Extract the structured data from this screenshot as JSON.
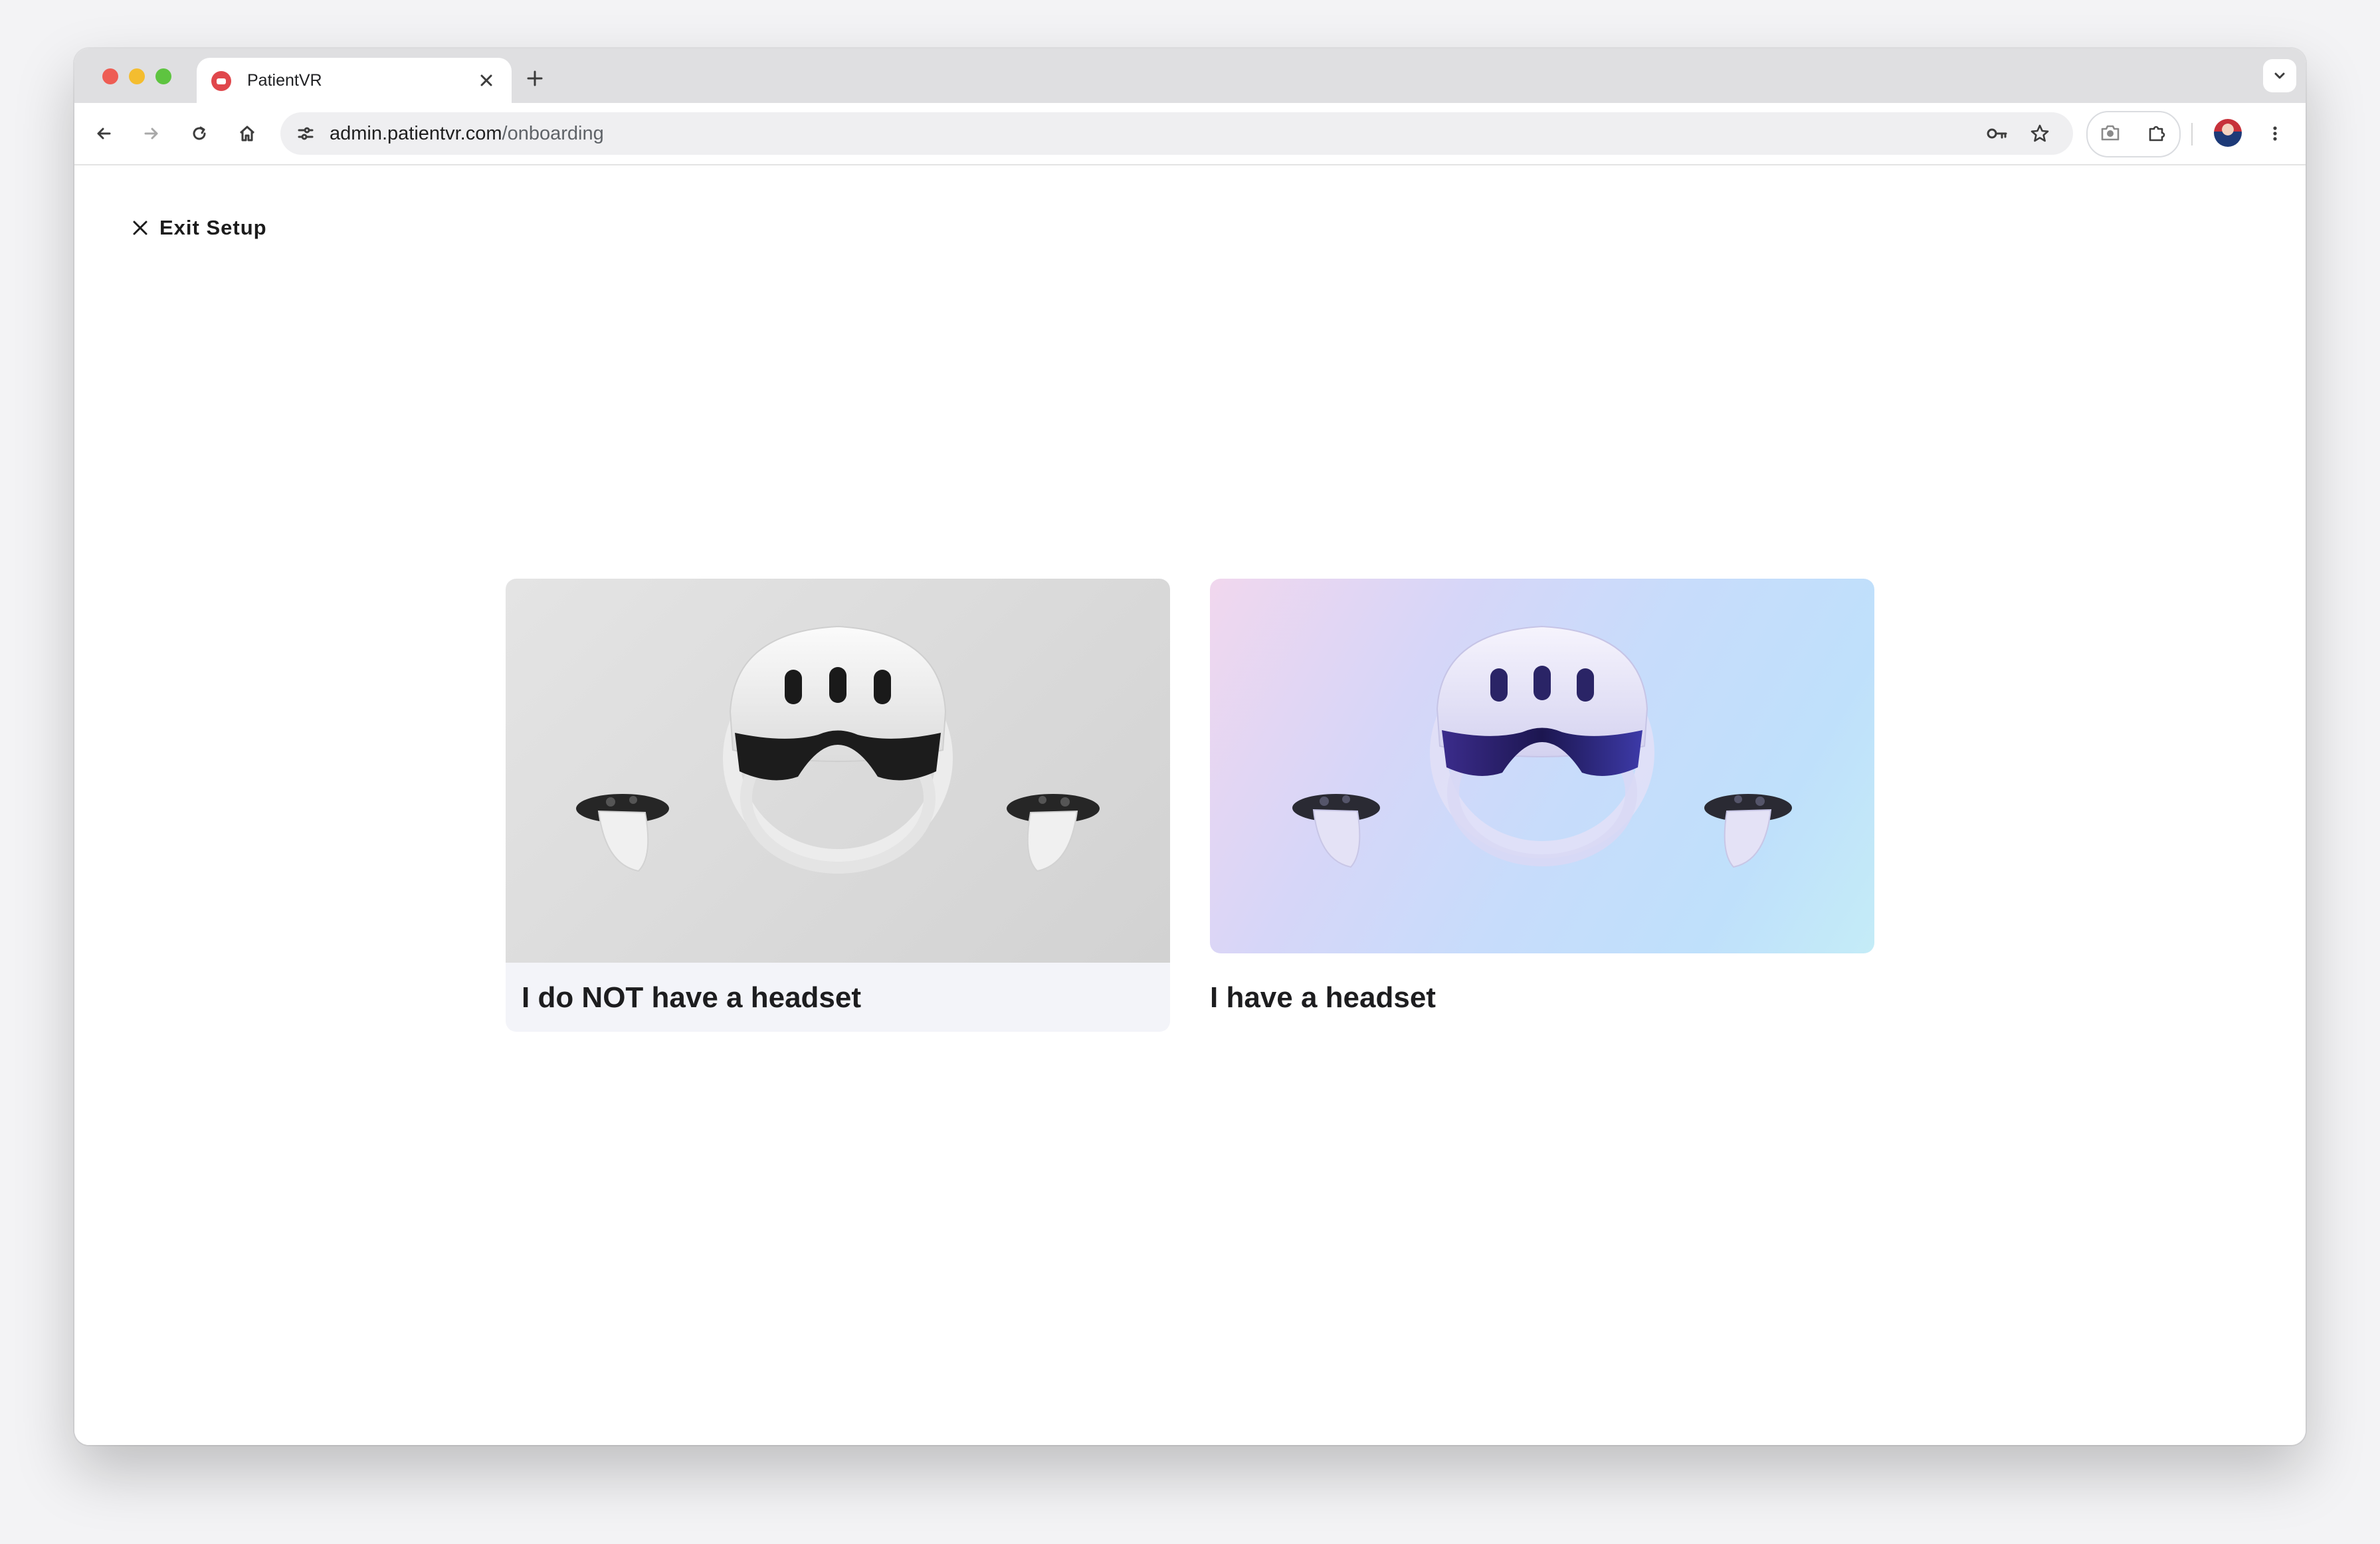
{
  "browser": {
    "tab": {
      "title": "PatientVR",
      "favicon": "patientvr-logo-icon",
      "close_icon": "close-icon"
    },
    "new_tab_icon": "plus-icon",
    "tab_menu_icon": "chevron-down-icon",
    "url": {
      "host": "admin.patientvr.com",
      "path": "/onboarding"
    },
    "toolbar_icons": [
      "back-arrow-icon",
      "forward-arrow-icon",
      "reload-icon",
      "home-icon",
      "site-settings-icon",
      "password-key-icon",
      "bookmark-star-icon",
      "screenshot-camera-icon",
      "extensions-puzzle-icon",
      "profile-avatar",
      "more-vert-icon"
    ]
  },
  "page": {
    "exit_label": "Exit Setup",
    "options": [
      {
        "label": "I do NOT have a headset",
        "image": "vr-headset-grey"
      },
      {
        "label": "I have a headset",
        "image": "vr-headset-gradient"
      }
    ]
  },
  "colors": {
    "brand_red": "#e0474c",
    "card_bg": "#f3f4f9",
    "text_dark": "#1d1d1f"
  }
}
